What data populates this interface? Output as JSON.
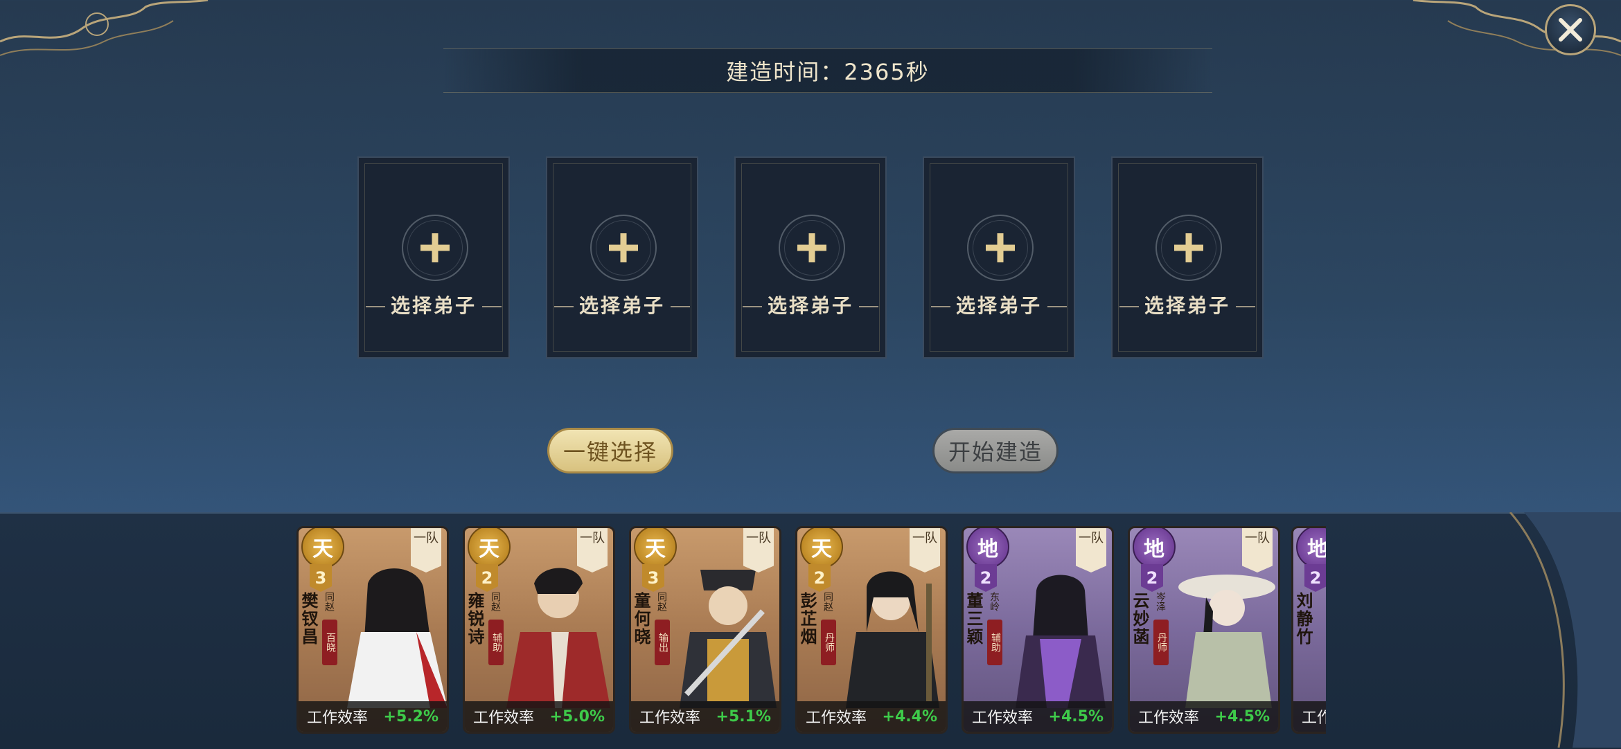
{
  "header": {
    "build_time": "建造时间：2365秒"
  },
  "slots": [
    {
      "label": "选择弟子"
    },
    {
      "label": "选择弟子"
    },
    {
      "label": "选择弟子"
    },
    {
      "label": "选择弟子"
    },
    {
      "label": "选择弟子"
    }
  ],
  "buttons": {
    "auto_select": "一键选择",
    "start_build": "开始建造"
  },
  "stat_label": "工作效率",
  "cards": [
    {
      "rank": "天",
      "star": "3",
      "team": "一队",
      "name": "樊钗昌",
      "sect": "同赵",
      "role": "百晓",
      "efficiency": "+5.2%",
      "tier": "gold"
    },
    {
      "rank": "天",
      "star": "2",
      "team": "一队",
      "name": "雍锐诗",
      "sect": "同赵",
      "role": "辅助",
      "efficiency": "+5.0%",
      "tier": "gold"
    },
    {
      "rank": "天",
      "star": "3",
      "team": "一队",
      "name": "童何晓",
      "sect": "同赵",
      "role": "输出",
      "efficiency": "+5.1%",
      "tier": "gold"
    },
    {
      "rank": "天",
      "star": "2",
      "team": "一队",
      "name": "彭芷烟",
      "sect": "同赵",
      "role": "丹师",
      "efficiency": "+4.4%",
      "tier": "gold"
    },
    {
      "rank": "地",
      "star": "2",
      "team": "一队",
      "name": "董三颖",
      "sect": "东岭",
      "role": "辅助",
      "efficiency": "+4.5%",
      "tier": "purple"
    },
    {
      "rank": "地",
      "star": "2",
      "team": "一队",
      "name": "云妙菡",
      "sect": "岑泽",
      "role": "丹师",
      "efficiency": "+4.5%",
      "tier": "purple"
    },
    {
      "rank": "地",
      "star": "2",
      "team": "",
      "name": "刘静竹",
      "sect": "",
      "role": "",
      "efficiency": "",
      "tier": "purple"
    }
  ]
}
